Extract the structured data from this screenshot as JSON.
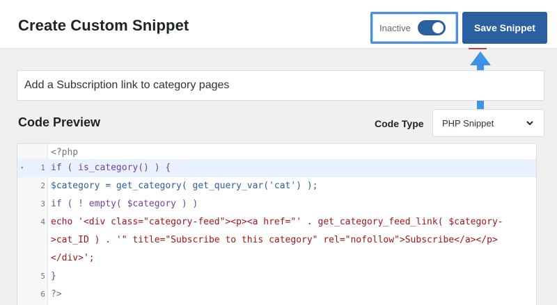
{
  "header": {
    "title": "Create Custom Snippet",
    "status_label": "Inactive",
    "toggle_on": true,
    "save_label": "Save Snippet",
    "accent_color": "#2a5fa0",
    "highlight_color": "#4a90e2"
  },
  "snippet_title": {
    "value": "Add a Subscription link to category pages"
  },
  "code_section": {
    "title": "Code Preview",
    "code_type_label": "Code Type",
    "code_type_value": "PHP Snippet"
  },
  "code_lines": [
    {
      "number": "",
      "text": "<?php"
    },
    {
      "number": "1",
      "text": "if ( is_category() ) {"
    },
    {
      "number": "2",
      "text": "$category = get_category( get_query_var('cat') );"
    },
    {
      "number": "3",
      "text": "if ( ! empty( $category ) )"
    },
    {
      "number": "4",
      "text": "echo '<div class=\"category-feed\"><p><a href=\"' . get_category_feed_link( $category-"
    },
    {
      "number": "",
      "text": ">cat_ID ) . '\" title=\"Subscribe to this category\" rel=\"nofollow\">Subscribe</a></p>"
    },
    {
      "number": "",
      "text": "</div>';"
    },
    {
      "number": "5",
      "text": "}"
    },
    {
      "number": "6",
      "text": "?>"
    }
  ]
}
